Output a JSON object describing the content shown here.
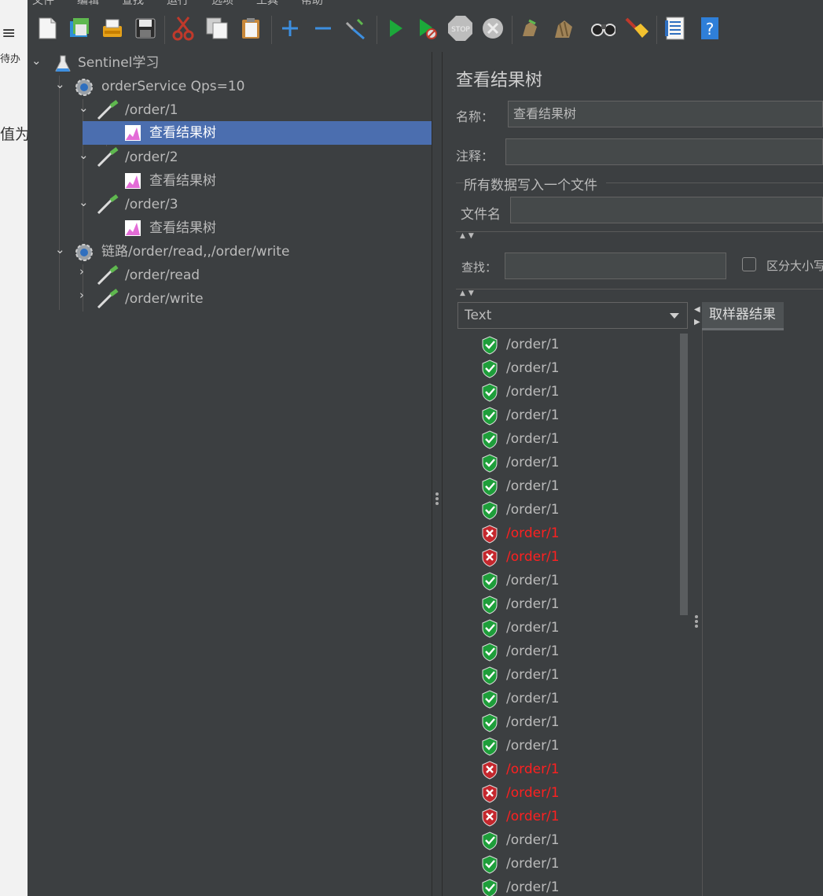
{
  "external": {
    "icon_text": "≡",
    "text1": "待办",
    "text2": "值为"
  },
  "menu": [
    "文件",
    "编辑",
    "查找",
    "运行",
    "选项",
    "工具",
    "帮助"
  ],
  "toolbar": {
    "buttons": [
      {
        "name": "new-icon"
      },
      {
        "name": "templates-icon"
      },
      {
        "name": "open-icon"
      },
      {
        "name": "save-icon"
      },
      {
        "name": "cut-icon"
      },
      {
        "name": "copy-icon"
      },
      {
        "name": "paste-icon"
      },
      {
        "name": "expand-icon"
      },
      {
        "name": "collapse-icon"
      },
      {
        "name": "toggle-icon"
      },
      {
        "name": "start-icon"
      },
      {
        "name": "start-no-pause-icon"
      },
      {
        "name": "stop-icon"
      },
      {
        "name": "shutdown-icon"
      },
      {
        "name": "clear-icon"
      },
      {
        "name": "clear-all-icon"
      },
      {
        "name": "search-icon"
      },
      {
        "name": "reset-search-icon"
      },
      {
        "name": "function-helper-icon"
      },
      {
        "name": "help-icon"
      }
    ],
    "stop_label": "STOP"
  },
  "tree": {
    "root": "Sentinel学习",
    "group1": "orderService Qps=10",
    "n1": "/order/1",
    "n1_listener": "查看结果树",
    "n2": "/order/2",
    "n2_listener": "查看结果树",
    "n3": "/order/3",
    "n3_listener": "查看结果树",
    "group2": "链路/order/read,,/order/write",
    "n4": "/order/read",
    "n5": "/order/write"
  },
  "panel": {
    "title": "查看结果树",
    "name_label": "名称：",
    "name_value": "查看结果树",
    "comment_label": "注释：",
    "comment_value": "",
    "file_section": "所有数据写入一个文件",
    "filename_label": "文件名",
    "filename_value": "",
    "search_label": "查找：",
    "search_value": "",
    "case_label": "区分大小写",
    "renderer": "Text",
    "tab": "取样器结果"
  },
  "results": [
    {
      "label": "/order/1",
      "ok": true
    },
    {
      "label": "/order/1",
      "ok": true
    },
    {
      "label": "/order/1",
      "ok": true
    },
    {
      "label": "/order/1",
      "ok": true
    },
    {
      "label": "/order/1",
      "ok": true
    },
    {
      "label": "/order/1",
      "ok": true
    },
    {
      "label": "/order/1",
      "ok": true
    },
    {
      "label": "/order/1",
      "ok": true
    },
    {
      "label": "/order/1",
      "ok": false
    },
    {
      "label": "/order/1",
      "ok": false
    },
    {
      "label": "/order/1",
      "ok": true
    },
    {
      "label": "/order/1",
      "ok": true
    },
    {
      "label": "/order/1",
      "ok": true
    },
    {
      "label": "/order/1",
      "ok": true
    },
    {
      "label": "/order/1",
      "ok": true
    },
    {
      "label": "/order/1",
      "ok": true
    },
    {
      "label": "/order/1",
      "ok": true
    },
    {
      "label": "/order/1",
      "ok": true
    },
    {
      "label": "/order/1",
      "ok": false
    },
    {
      "label": "/order/1",
      "ok": false
    },
    {
      "label": "/order/1",
      "ok": false
    },
    {
      "label": "/order/1",
      "ok": true
    },
    {
      "label": "/order/1",
      "ok": true
    },
    {
      "label": "/order/1",
      "ok": true
    }
  ],
  "colors": {
    "success": "#1e9e3a",
    "error": "#c4272d",
    "error_text": "#ff2020",
    "selection": "#4b6eaf"
  }
}
